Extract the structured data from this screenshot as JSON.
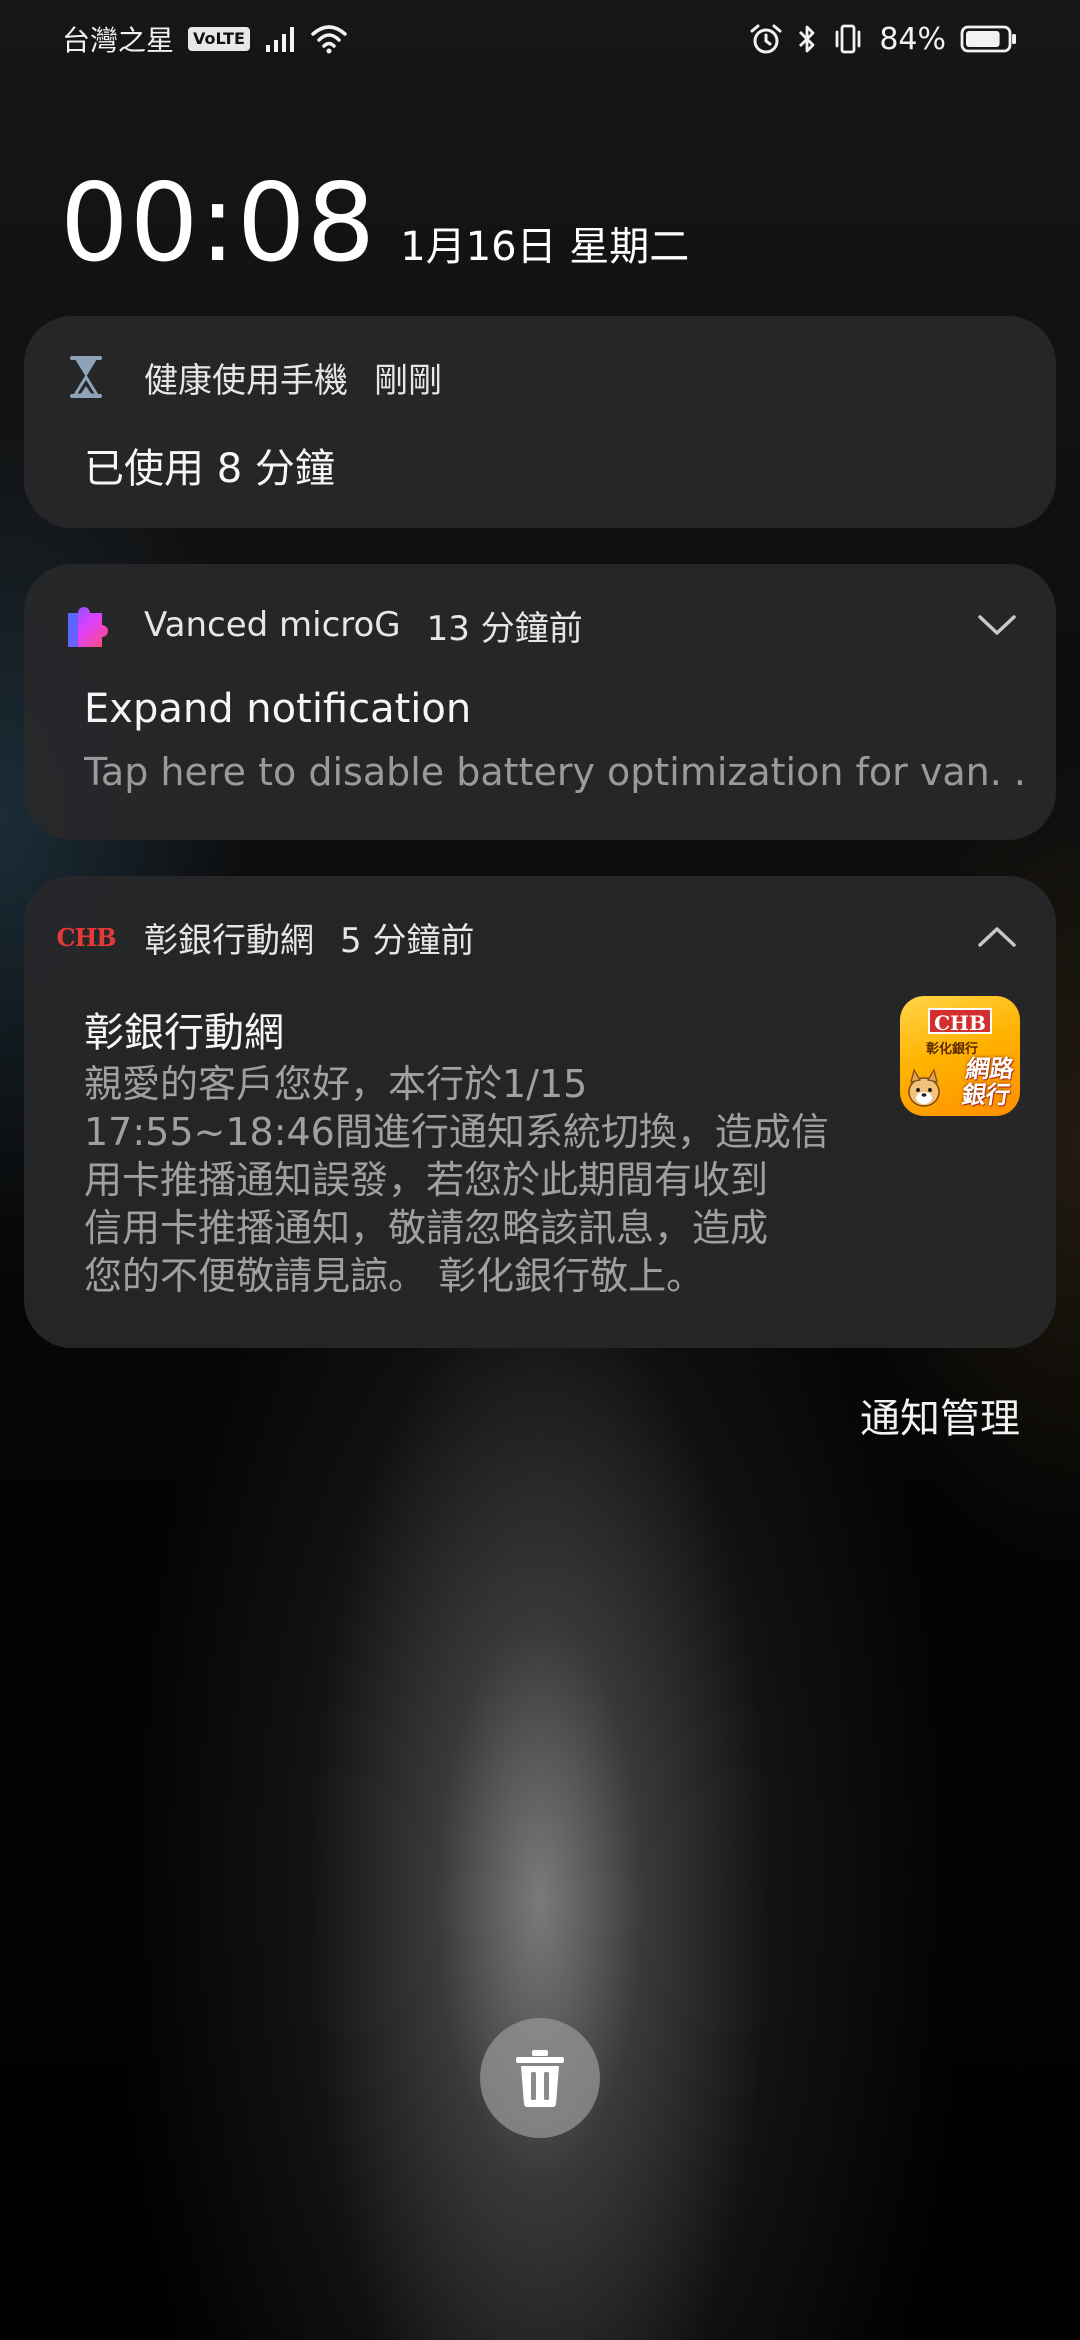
{
  "status_bar": {
    "carrier": "台灣之星",
    "volte": "VoLTE",
    "signal_icon": "signal-bars-icon",
    "wifi_icon": "wifi-icon",
    "alarm_icon": "alarm-icon",
    "bluetooth_icon": "bluetooth-icon",
    "vibrate_icon": "vibrate-icon",
    "battery_percent": "84%",
    "battery_level": 0.84
  },
  "lock_clock": {
    "time": "00:08",
    "date": "1月16日 星期二"
  },
  "notifications": [
    {
      "app": "健康使用手機",
      "time_ago": "剛剛",
      "icon": "hourglass-icon",
      "title": "已使用 8 分鐘"
    },
    {
      "app": "Vanced microG",
      "time_ago": "13 分鐘前",
      "icon": "puzzle-icon",
      "title": "Expand notification",
      "body": "Tap here to disable battery optimization for van. .",
      "chevron": "chevron-down-icon"
    },
    {
      "app": "彰銀行動網",
      "time_ago": "5 分鐘前",
      "icon_text": "CHB",
      "title": "彰銀行動網",
      "body_lines": [
        "親愛的客戶您好，本行於1/15",
        "17:55~18:46間進行通知系統切換，造成信",
        "用卡推播通知誤發，若您於此期間有收到",
        "信用卡推播通知，敬請忽略該訊息，造成",
        "您的不便敬請見諒。 彰化銀行敬上。"
      ],
      "chevron": "chevron-up-icon",
      "thumbnail": {
        "logo_text": "CHB",
        "bank_name": "彰化銀行",
        "tag_lines": [
          "網路",
          "銀行"
        ]
      }
    }
  ],
  "manage_label": "通知管理",
  "clear_icon": "trash-icon"
}
